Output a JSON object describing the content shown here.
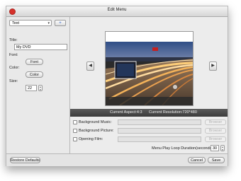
{
  "window": {
    "title": "Edit Menu"
  },
  "left": {
    "type_select": "Text",
    "add_button": "+",
    "title_label": "Title:",
    "title_value": "My DVD",
    "font_label": "Font:",
    "font_button": "Font",
    "color_label": "Color:",
    "color_button": "Color",
    "size_label": "Size:",
    "size_value": "22"
  },
  "preview": {
    "prev_arrow": "◀",
    "next_arrow": "▶",
    "aspect": "Current Aspect:4:3",
    "resolution": "Current Resolution:720*480"
  },
  "options": {
    "bg_music": "Background Music:",
    "bg_picture": "Background Picture:",
    "opening_film": "Opening Film:",
    "browser_label": "Browser",
    "loop_label": "Menu Play Loop Duration(seconds):",
    "loop_value": "30"
  },
  "footer": {
    "restore": "Restore Defaults",
    "cancel": "Cancel",
    "save": "Save"
  }
}
